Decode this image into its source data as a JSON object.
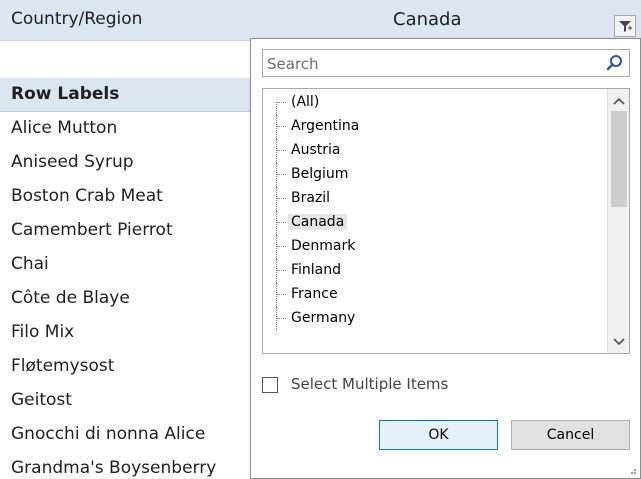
{
  "filter": {
    "field_label": "Country/Region",
    "selected_value": "Canada"
  },
  "pivot": {
    "header": "Row Labels",
    "rows": [
      "Alice Mutton",
      "Aniseed Syrup",
      "Boston Crab Meat",
      "Camembert Pierrot",
      "Chai",
      "Côte de Blaye",
      "Filo Mix",
      "Fløtemysost",
      "Geitost",
      "Gnocchi di nonna Alice",
      "Grandma's Boysenberry"
    ]
  },
  "popup": {
    "search_placeholder": "Search",
    "items": [
      "(All)",
      "Argentina",
      "Austria",
      "Belgium",
      "Brazil",
      "Canada",
      "Denmark",
      "Finland",
      "France",
      "Germany"
    ],
    "selected_item": "Canada",
    "select_multiple_label": "Select Multiple Items",
    "ok_label": "OK",
    "cancel_label": "Cancel"
  },
  "icons": {
    "filter": "filter-funnel-icon",
    "search": "search-icon",
    "scroll_up": "chevron-up-icon",
    "scroll_down": "chevron-down-icon",
    "resize": "resize-grip-icon"
  },
  "colors": {
    "header_fill": "#dce6f1",
    "ok_border": "#0078d7",
    "selected_item_fill": "#e5e5e5"
  }
}
